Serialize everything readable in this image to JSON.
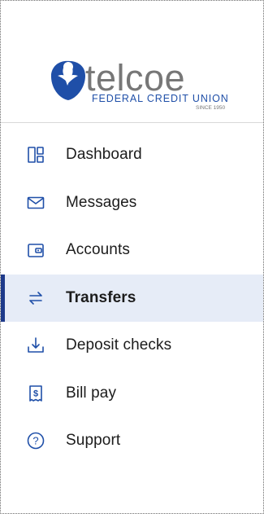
{
  "brand": {
    "name": "telcoe",
    "tagline": "FEDERAL CREDIT UNION",
    "since": "SINCE 1950",
    "primary_color": "#1f4fa8",
    "dark_color": "#1e3a8a",
    "gray_color": "#777777"
  },
  "nav": {
    "items": [
      {
        "label": "Dashboard",
        "icon": "dashboard-icon",
        "active": false
      },
      {
        "label": "Messages",
        "icon": "envelope-icon",
        "active": false
      },
      {
        "label": "Accounts",
        "icon": "wallet-icon",
        "active": false
      },
      {
        "label": "Transfers",
        "icon": "transfer-arrows-icon",
        "active": true
      },
      {
        "label": "Deposit checks",
        "icon": "download-icon",
        "active": false
      },
      {
        "label": "Bill pay",
        "icon": "receipt-dollar-icon",
        "active": false
      },
      {
        "label": "Support",
        "icon": "question-circle-icon",
        "active": false
      }
    ]
  }
}
